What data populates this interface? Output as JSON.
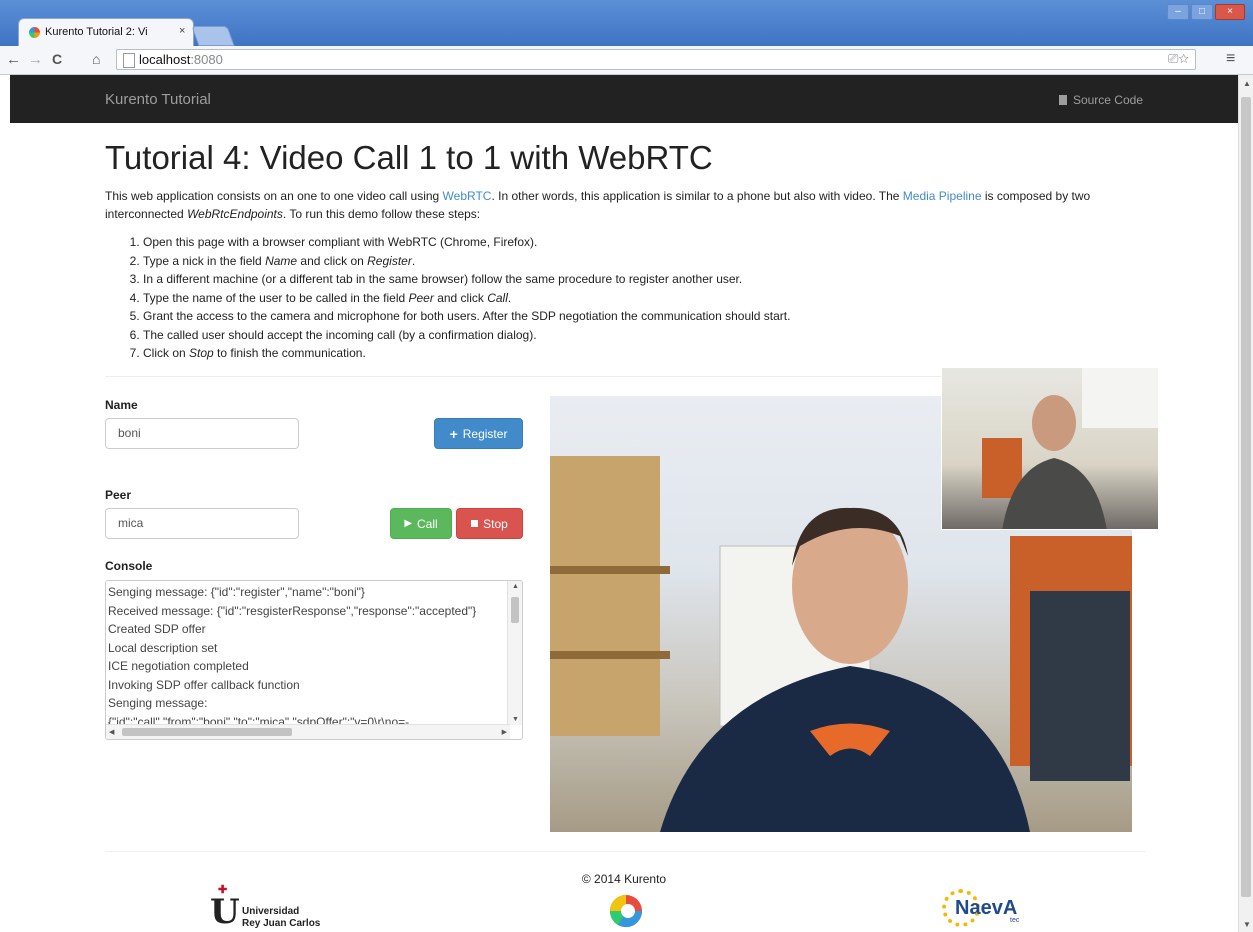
{
  "browser": {
    "tab_title": "Kurento Tutorial 2: Vi",
    "tab_close": "×",
    "url_host": "localhost",
    "url_port": ":8080",
    "nav_back": "←",
    "nav_forward": "→",
    "nav_reload": "C",
    "nav_home": "⌂",
    "omni_icons": "⎚☆",
    "menu": "≡",
    "win_min": "–",
    "win_max": "□",
    "win_close": "×"
  },
  "navbar": {
    "brand": "Kurento Tutorial",
    "source_code": "Source Code"
  },
  "page": {
    "title": "Tutorial 4: Video Call 1 to 1 with WebRTC",
    "intro": {
      "p1": "This web application consists on an one to one video call using ",
      "link_webrtc": "WebRTC",
      "p2": ". In other words, this application is similar to a phone but also with video. The ",
      "link_pipeline": "Media Pipeline",
      "p3": " is composed by two interconnected ",
      "em_endpoints": "WebRtcEndpoints",
      "p4": ". To run this demo follow these steps:"
    },
    "steps": {
      "s1": "Open this page with a browser compliant with WebRTC (Chrome, Firefox).",
      "s2a": "Type a nick in the field ",
      "s2_name": "Name",
      "s2b": " and click on ",
      "s2_register": "Register",
      "s2c": ".",
      "s3": "In a different machine (or a different tab in the same browser) follow the same procedure to register another user.",
      "s4a": "Type the name of the user to be called in the field ",
      "s4_peer": "Peer",
      "s4b": " and click ",
      "s4_call": "Call",
      "s4c": ".",
      "s5": "Grant the access to the camera and microphone for both users. After the SDP negotiation the communication should start.",
      "s6": "The called user should accept the incoming call (by a confirmation dialog).",
      "s7a": "Click on ",
      "s7_stop": "Stop",
      "s7b": " to finish the communication."
    }
  },
  "form": {
    "name_label": "Name",
    "name_value": "boni",
    "register_button": "Register",
    "peer_label": "Peer",
    "peer_value": "mica",
    "call_button": "Call",
    "stop_button": "Stop",
    "console_label": "Console"
  },
  "console": {
    "lines": [
      "Senging message: {\"id\":\"register\",\"name\":\"boni\"}",
      "Received message: {\"id\":\"resgisterResponse\",\"response\":\"accepted\"}",
      "Created SDP offer",
      "Local description set",
      "ICE negotiation completed",
      "Invoking SDP offer callback function",
      "Senging message:",
      "{\"id\":\"call\",\"from\":\"boni\",\"to\":\"mica\",\"sdpOffer\":\"v=0\\r\\no=-"
    ]
  },
  "footer": {
    "copyright": "© 2014 Kurento",
    "urjc_line1": "Universidad",
    "urjc_line2": "Rey Juan Carlos",
    "naeva": "NaevA",
    "naeva_sub": "tec"
  },
  "colors": {
    "navbar": "#222222",
    "link": "#428bca",
    "primary": "#428bca",
    "success": "#5cb85c",
    "danger": "#d9534f"
  }
}
